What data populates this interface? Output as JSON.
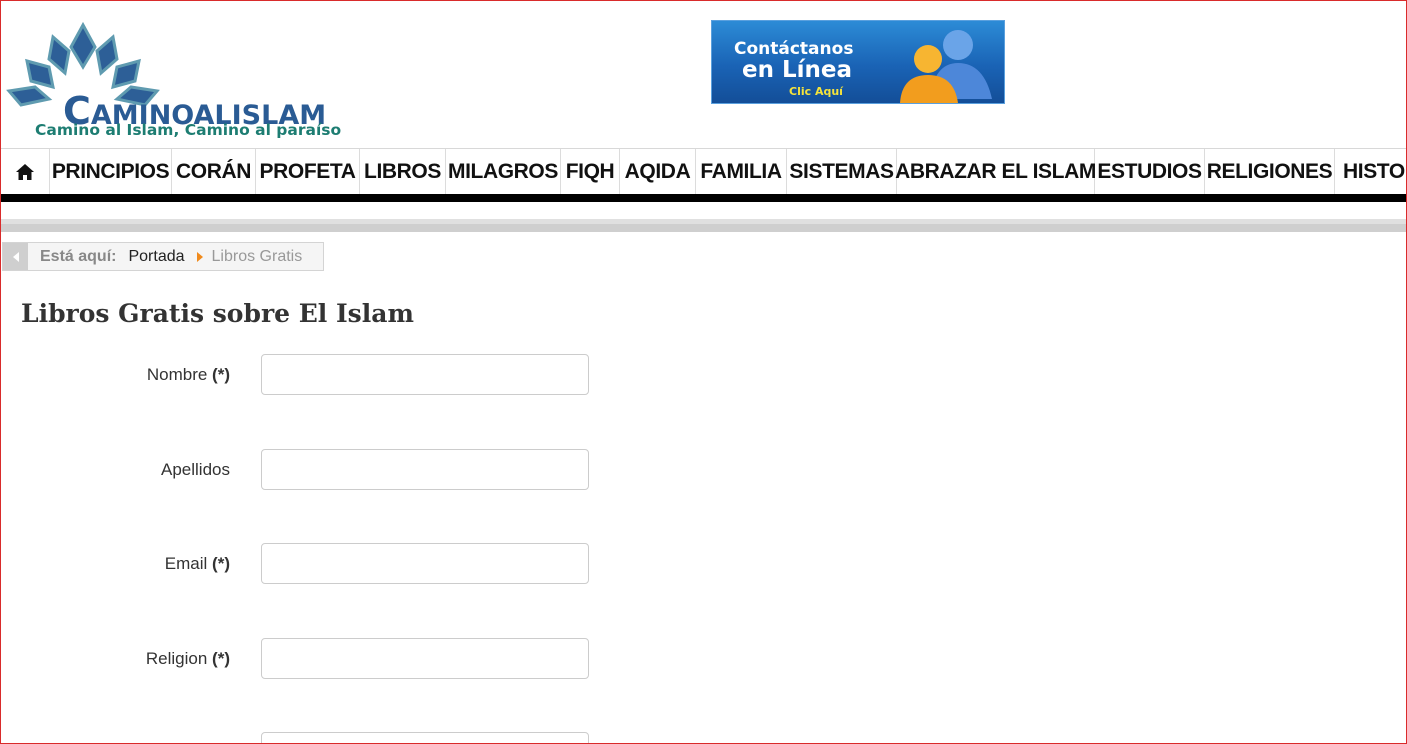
{
  "header": {
    "logo": {
      "name_first": "C",
      "name_rest": "AMINOALISLAM",
      "tagline": "Camino al Islam, Camino al paraíso"
    },
    "banner": {
      "line1": "Contáctanos",
      "line2": "en Línea",
      "line3": "Clic Aquí"
    }
  },
  "nav": {
    "home_icon": "home-icon",
    "items": [
      {
        "label": "PRINCIPIOS"
      },
      {
        "label": "CORÁN"
      },
      {
        "label": "PROFETA"
      },
      {
        "label": "LIBROS"
      },
      {
        "label": "MILAGROS"
      },
      {
        "label": "FIQH"
      },
      {
        "label": "AQIDA"
      },
      {
        "label": "FAMILIA"
      },
      {
        "label": "SISTEMAS"
      },
      {
        "label": "ABRAZAR EL ISLAM"
      },
      {
        "label": "ESTUDIOS"
      },
      {
        "label": "RELIGIONES"
      },
      {
        "label": "HISTOR"
      }
    ]
  },
  "breadcrumb": {
    "here_label": "Está aquí:",
    "home": "Portada",
    "current": "Libros Gratis"
  },
  "main": {
    "title": "Libros Gratis sobre El Islam",
    "form": {
      "fields": [
        {
          "label": "Nombre",
          "required": "(*)",
          "value": ""
        },
        {
          "label": "Apellidos",
          "required": "",
          "value": ""
        },
        {
          "label": "Email",
          "required": "(*)",
          "value": ""
        },
        {
          "label": "Religion",
          "required": "(*)",
          "value": ""
        },
        {
          "label": "",
          "required": "",
          "value": ""
        }
      ]
    }
  },
  "colors": {
    "nav_bar": "#000000",
    "breadcrumb_arrow": "#f08a1c",
    "logo_blue": "#2a5b94",
    "logo_teal": "#1d7d72",
    "frame_border": "#d92b2b"
  }
}
